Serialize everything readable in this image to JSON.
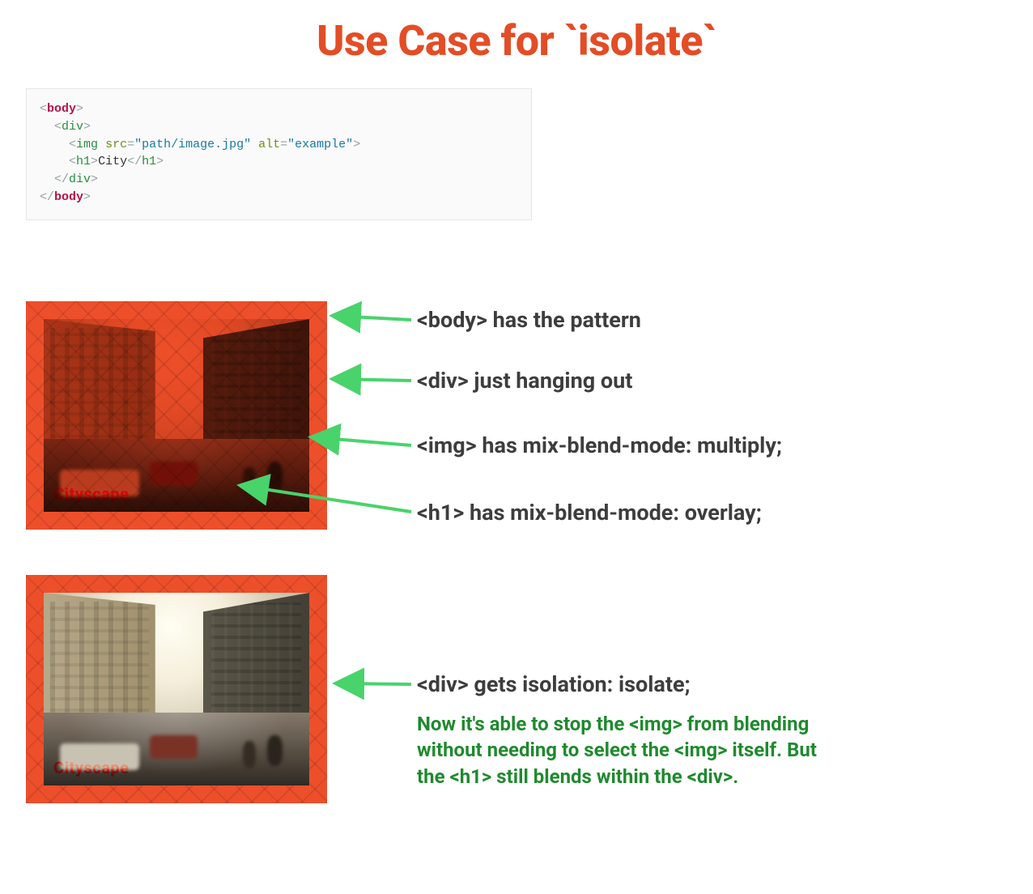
{
  "title_prefix": "Use Case for ",
  "title_code": "`isolate`",
  "code": {
    "img_src": "\"path/image.jpg\"",
    "img_alt": "\"example\"",
    "h1_text": "City"
  },
  "caption": "Cityscape",
  "notes": {
    "body_pattern": "<body> has the pattern",
    "div_hanging": "<div> just hanging out",
    "img_multiply": "<img> has mix-blend-mode: multiply;",
    "h1_overlay": "<h1> has mix-blend-mode: overlay;",
    "div_isolate": "<div> gets isolation: isolate;",
    "explanation": "Now it's able to stop the <img> from blending without needing to select the <img> itself. But the <h1> still blends within the <div>."
  }
}
